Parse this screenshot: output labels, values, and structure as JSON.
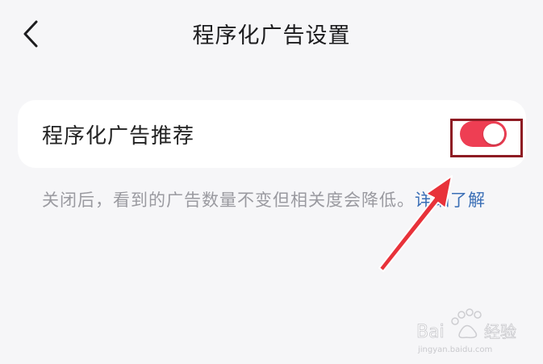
{
  "header": {
    "title": "程序化广告设置",
    "back_icon": "chevron-left-icon"
  },
  "setting": {
    "label": "程序化广告推荐",
    "toggle_state": "on",
    "toggle_color": "#ee3e53"
  },
  "description": {
    "text": "关闭后，看到的广告数量不变但相关度会降低。",
    "link_text": "详细了解"
  },
  "annotations": {
    "highlight_color": "#8e1b23",
    "arrow_color": "#e8323a"
  },
  "watermark": {
    "brand": "Bai",
    "brand_suffix": "经验",
    "url": "jingyan.baidu.com"
  }
}
